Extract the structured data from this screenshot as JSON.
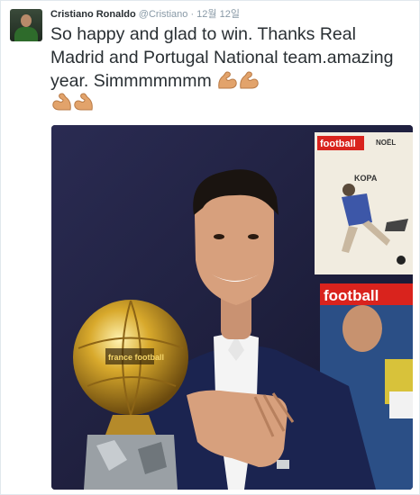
{
  "tweet": {
    "author_name": "Cristiano Ronaldo",
    "handle": "@Cristiano",
    "separator": "·",
    "timestamp": "12월 12일",
    "text": "So happy and glad to win. Thanks Real Madrid and Portugal National team.amazing year. Simmmmmmm",
    "emoji_name": "flexed-biceps-icon"
  },
  "photo": {
    "magazine_top": {
      "masthead": "football",
      "masthead_right": "NOËL",
      "cover_word": "KOPA"
    },
    "magazine_bottom": {
      "masthead": "football"
    },
    "trophy_band_text": "france football"
  },
  "colors": {
    "name": "#292f33",
    "meta": "#8899a6",
    "photo_background": "#1c1d3a",
    "magazine_red": "#d9231d"
  }
}
